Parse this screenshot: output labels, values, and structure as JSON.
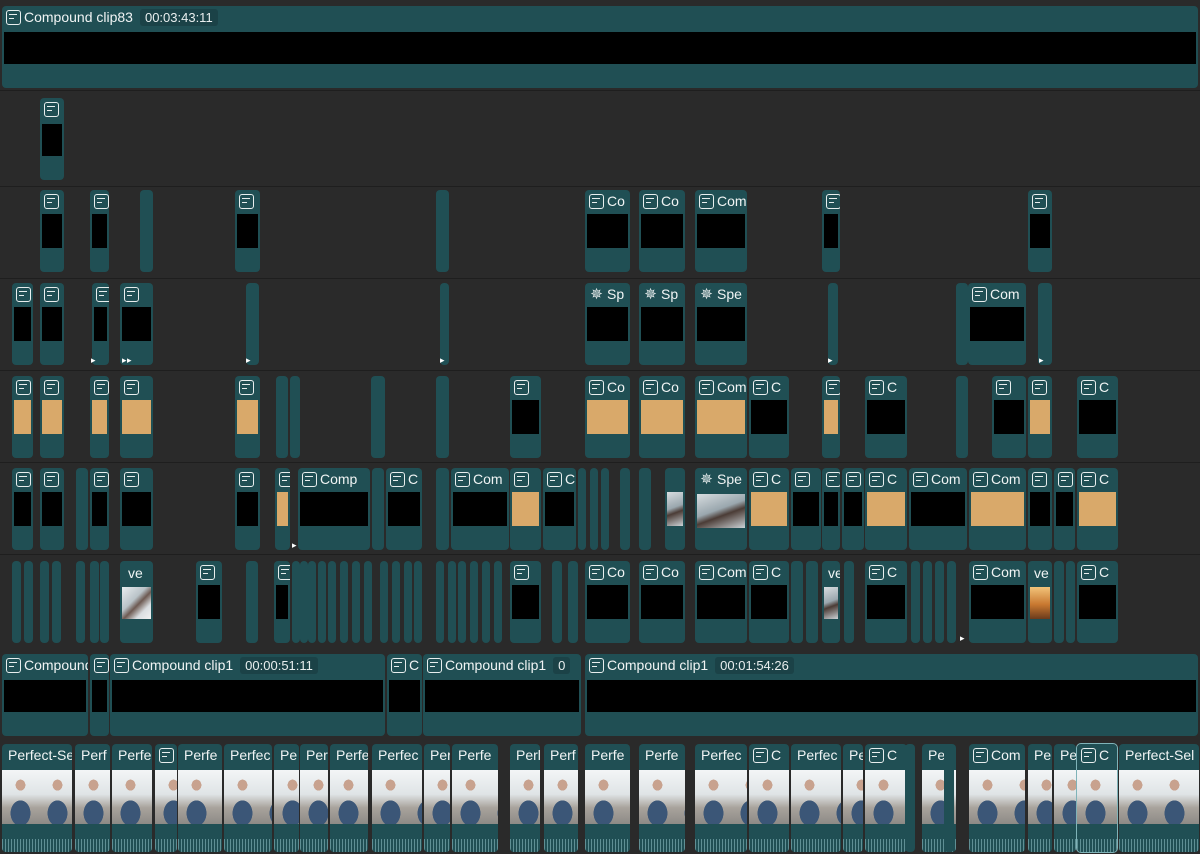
{
  "top_clip": {
    "label": "Compound clip83",
    "timecode": "00:03:43:11"
  },
  "compound_lane": [
    {
      "label": "Compound",
      "timecode": ""
    },
    {
      "label": "Compound clip1",
      "timecode": "00:00:51:11"
    },
    {
      "label": "C",
      "timecode": ""
    },
    {
      "label": "Compound clip1",
      "timecode": "0"
    },
    {
      "label": "Compound clip1",
      "timecode": "00:01:54:26"
    }
  ],
  "short_labels": {
    "co": "Co",
    "com": "Com",
    "comp": "Comp",
    "compound": "Compound",
    "c": "C",
    "sp": "Sp",
    "spe": "Spe",
    "ve": "ve",
    "v": "v"
  },
  "bottom_labels": [
    "Perfect-Se",
    "Perf",
    "Perfe",
    "Perfe",
    "Perfec",
    "Pe",
    "Per",
    "Perfe",
    "Perfec",
    "Perf",
    "Perfe",
    "Perl",
    "Perf",
    "Perfe",
    "Perfe",
    "Perfec",
    "C",
    "Perfec",
    "Pe",
    "C",
    "Perl",
    "Com",
    "Pe",
    "Pe",
    "C",
    "Perfect-Sel"
  ],
  "icons": {
    "compound": "compound-clip-icon",
    "effect": "spark-effect-icon"
  },
  "colors": {
    "clip": "#204f54",
    "background": "#2a2a2a",
    "tan": "#d9a96a"
  }
}
